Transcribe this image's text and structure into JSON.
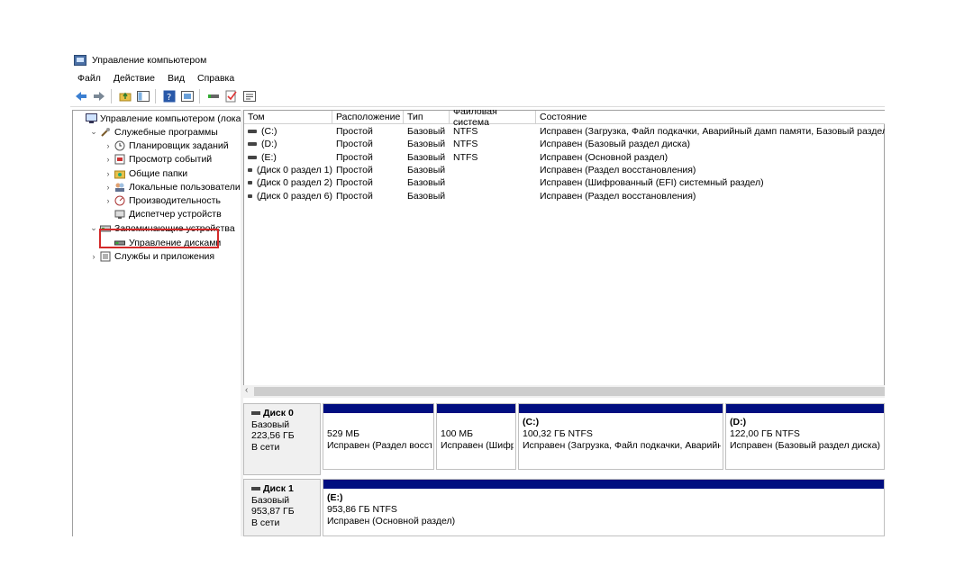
{
  "window": {
    "title": "Управление компьютером"
  },
  "menu": [
    "Файл",
    "Действие",
    "Вид",
    "Справка"
  ],
  "toolbar": {
    "icons": [
      "back-arrow-icon",
      "forward-arrow-icon",
      "up-folder-icon",
      "show-hide-tree-icon",
      "help-icon",
      "properties-icon",
      "connect-icon",
      "check-icon",
      "list-icon"
    ]
  },
  "tree": [
    {
      "label": "Управление компьютером (локаль",
      "chev": "",
      "indent": 0,
      "icon": "computer-management-icon"
    },
    {
      "label": "Служебные программы",
      "chev": "⌄",
      "indent": 1,
      "icon": "tools-icon"
    },
    {
      "label": "Планировщик заданий",
      "chev": "›",
      "indent": 2,
      "icon": "clock-icon"
    },
    {
      "label": "Просмотр событий",
      "chev": "›",
      "indent": 2,
      "icon": "event-viewer-icon"
    },
    {
      "label": "Общие папки",
      "chev": "›",
      "indent": 2,
      "icon": "shared-folders-icon"
    },
    {
      "label": "Локальные пользователи и",
      "chev": "›",
      "indent": 2,
      "icon": "users-icon"
    },
    {
      "label": "Производительность",
      "chev": "›",
      "indent": 2,
      "icon": "performance-icon"
    },
    {
      "label": "Диспетчер устройств",
      "chev": "",
      "indent": 2,
      "icon": "device-manager-icon"
    },
    {
      "label": "Запоминающие устройства",
      "chev": "⌄",
      "indent": 1,
      "icon": "storage-icon"
    },
    {
      "label": "Управление дисками",
      "chev": "",
      "indent": 2,
      "icon": "disk-management-icon",
      "selected": true
    },
    {
      "label": "Службы и приложения",
      "chev": "›",
      "indent": 1,
      "icon": "services-icon"
    }
  ],
  "columns": [
    "Том",
    "Расположение",
    "Тип",
    "Файловая система",
    "Состояние"
  ],
  "volumes": [
    [
      "(C:)",
      "Простой",
      "Базовый",
      "NTFS",
      "Исправен (Загрузка, Файл подкачки, Аварийный дамп памяти, Базовый раздел ди"
    ],
    [
      "(D:)",
      "Простой",
      "Базовый",
      "NTFS",
      "Исправен (Базовый раздел диска)"
    ],
    [
      "(E:)",
      "Простой",
      "Базовый",
      "NTFS",
      "Исправен (Основной раздел)"
    ],
    [
      "(Диск 0 раздел 1)",
      "Простой",
      "Базовый",
      "",
      "Исправен (Раздел восстановления)"
    ],
    [
      "(Диск 0 раздел 2)",
      "Простой",
      "Базовый",
      "",
      "Исправен (Шифрованный (EFI) системный раздел)"
    ],
    [
      "(Диск 0 раздел 6)",
      "Простой",
      "Базовый",
      "",
      "Исправен (Раздел восстановления)"
    ]
  ],
  "disks": [
    {
      "name": "Диск 0",
      "type": "Базовый",
      "size": "223,56 ГБ",
      "status": "В сети",
      "partitions": [
        {
          "title": "",
          "size": "529 МБ",
          "status": "Исправен (Раздел восст"
        },
        {
          "title": "",
          "size": "100 МБ",
          "status": "Исправен (Шифр"
        },
        {
          "title": "(C:)",
          "size": "100,32 ГБ NTFS",
          "status": "Исправен (Загрузка, Файл подкачки, Аварийн"
        },
        {
          "title": "(D:)",
          "size": "122,00 ГБ NTFS",
          "status": "Исправен (Базовый раздел диска)"
        }
      ]
    },
    {
      "name": "Диск 1",
      "type": "Базовый",
      "size": "953,87 ГБ",
      "status": "В сети",
      "partitions": [
        {
          "title": "(E:)",
          "size": "953,86 ГБ NTFS",
          "status": "Исправен (Основной раздел)"
        }
      ]
    }
  ],
  "colors": {
    "partition_bar": "#000e80",
    "highlight_border": "#d32a2a"
  }
}
